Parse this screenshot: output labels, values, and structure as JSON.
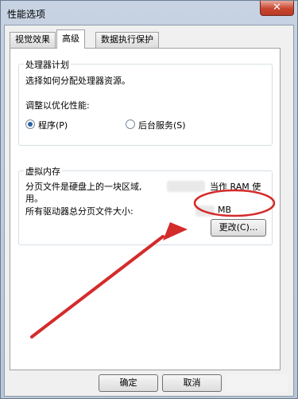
{
  "window": {
    "title": "性能选项",
    "close_glyph": "✕"
  },
  "tabs": [
    {
      "label": "视觉效果",
      "active": false
    },
    {
      "label": "高级",
      "active": true
    },
    {
      "label": "数据执行保护",
      "active": false
    }
  ],
  "processor": {
    "legend": "处理器计划",
    "description": "选择如何分配处理器资源。",
    "optimize_label": "调整以优化性能:",
    "option_programs": "程序(P)",
    "option_services": "后台服务(S)",
    "selected": "程序(P)"
  },
  "virtual_memory": {
    "legend": "虚拟内存",
    "line1_start": "分页文件是硬盘上的一块区域,",
    "line1_end": "当作 RAM 使",
    "line2": "用。",
    "total_label": "所有驱动器总分页文件大小:",
    "total_unit": "MB",
    "change_button": "更改(C)..."
  },
  "footer": {
    "ok_button": "确定",
    "cancel_button": "取消"
  },
  "colors": {
    "annotation_red": "#d42b2b"
  }
}
